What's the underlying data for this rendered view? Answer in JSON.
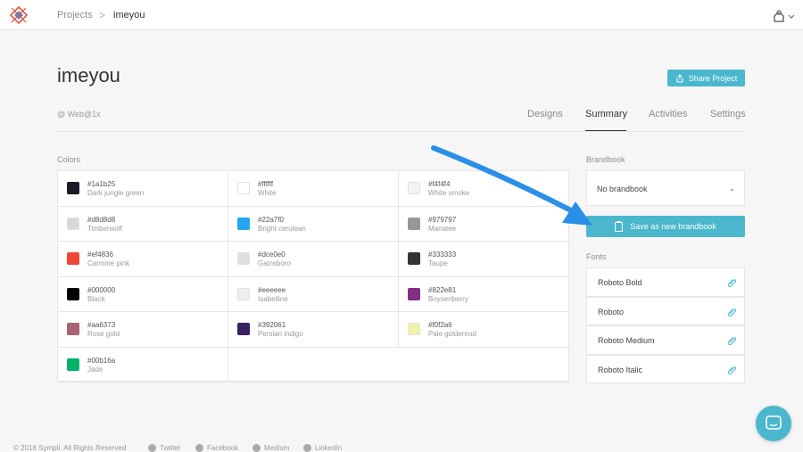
{
  "breadcrumb": {
    "root": "Projects",
    "separator": ">",
    "current": "imeyou"
  },
  "header": {
    "title": "imeyou",
    "platform": "@ Web@1x",
    "share_label": "Share Project",
    "tabs": [
      {
        "label": "Designs",
        "active": false
      },
      {
        "label": "Summary",
        "active": true
      },
      {
        "label": "Activities",
        "active": false
      },
      {
        "label": "Settings",
        "active": false
      }
    ]
  },
  "colors": {
    "label": "Colors",
    "items": [
      {
        "hex": "#1a1b25",
        "name": "Dark jungle green"
      },
      {
        "hex": "#ffffff",
        "name": "White"
      },
      {
        "hex": "#f4f4f4",
        "name": "White smoke"
      },
      {
        "hex": "#d8d8d8",
        "name": "Timberwolf"
      },
      {
        "hex": "#22a7f0",
        "name": "Bright cerulean"
      },
      {
        "hex": "#979797",
        "name": "Manatee"
      },
      {
        "hex": "#ef4836",
        "name": "Carmine pink"
      },
      {
        "hex": "#dce0e0",
        "name": "Gainsboro"
      },
      {
        "hex": "#333333",
        "name": "Taupe"
      },
      {
        "hex": "#000000",
        "name": "Black"
      },
      {
        "hex": "#eeeeee",
        "name": "Isabelline"
      },
      {
        "hex": "#822e81",
        "name": "Boysenberry"
      },
      {
        "hex": "#aa6373",
        "name": "Rose gold"
      },
      {
        "hex": "#392061",
        "name": "Persian indigo"
      },
      {
        "hex": "#f0f2a6",
        "name": "Pale goldenrod"
      },
      {
        "hex": "#00b16a",
        "name": "Jade"
      }
    ]
  },
  "brandbook": {
    "label": "Brandbook",
    "selected": "No brandbook",
    "save_label": "Save as new brandbook"
  },
  "fonts": {
    "label": "Fonts",
    "items": [
      "Roboto Bold",
      "Roboto",
      "Roboto Medium",
      "Roboto Italic"
    ]
  },
  "footer": {
    "copyright": "© 2016 Sympli. All Rights Reserved",
    "links": [
      "Twitter",
      "Facebook",
      "Medium",
      "LinkedIn"
    ]
  },
  "theme": {
    "accent": "#4ab7cd",
    "arrow": "#2b8fe8"
  }
}
